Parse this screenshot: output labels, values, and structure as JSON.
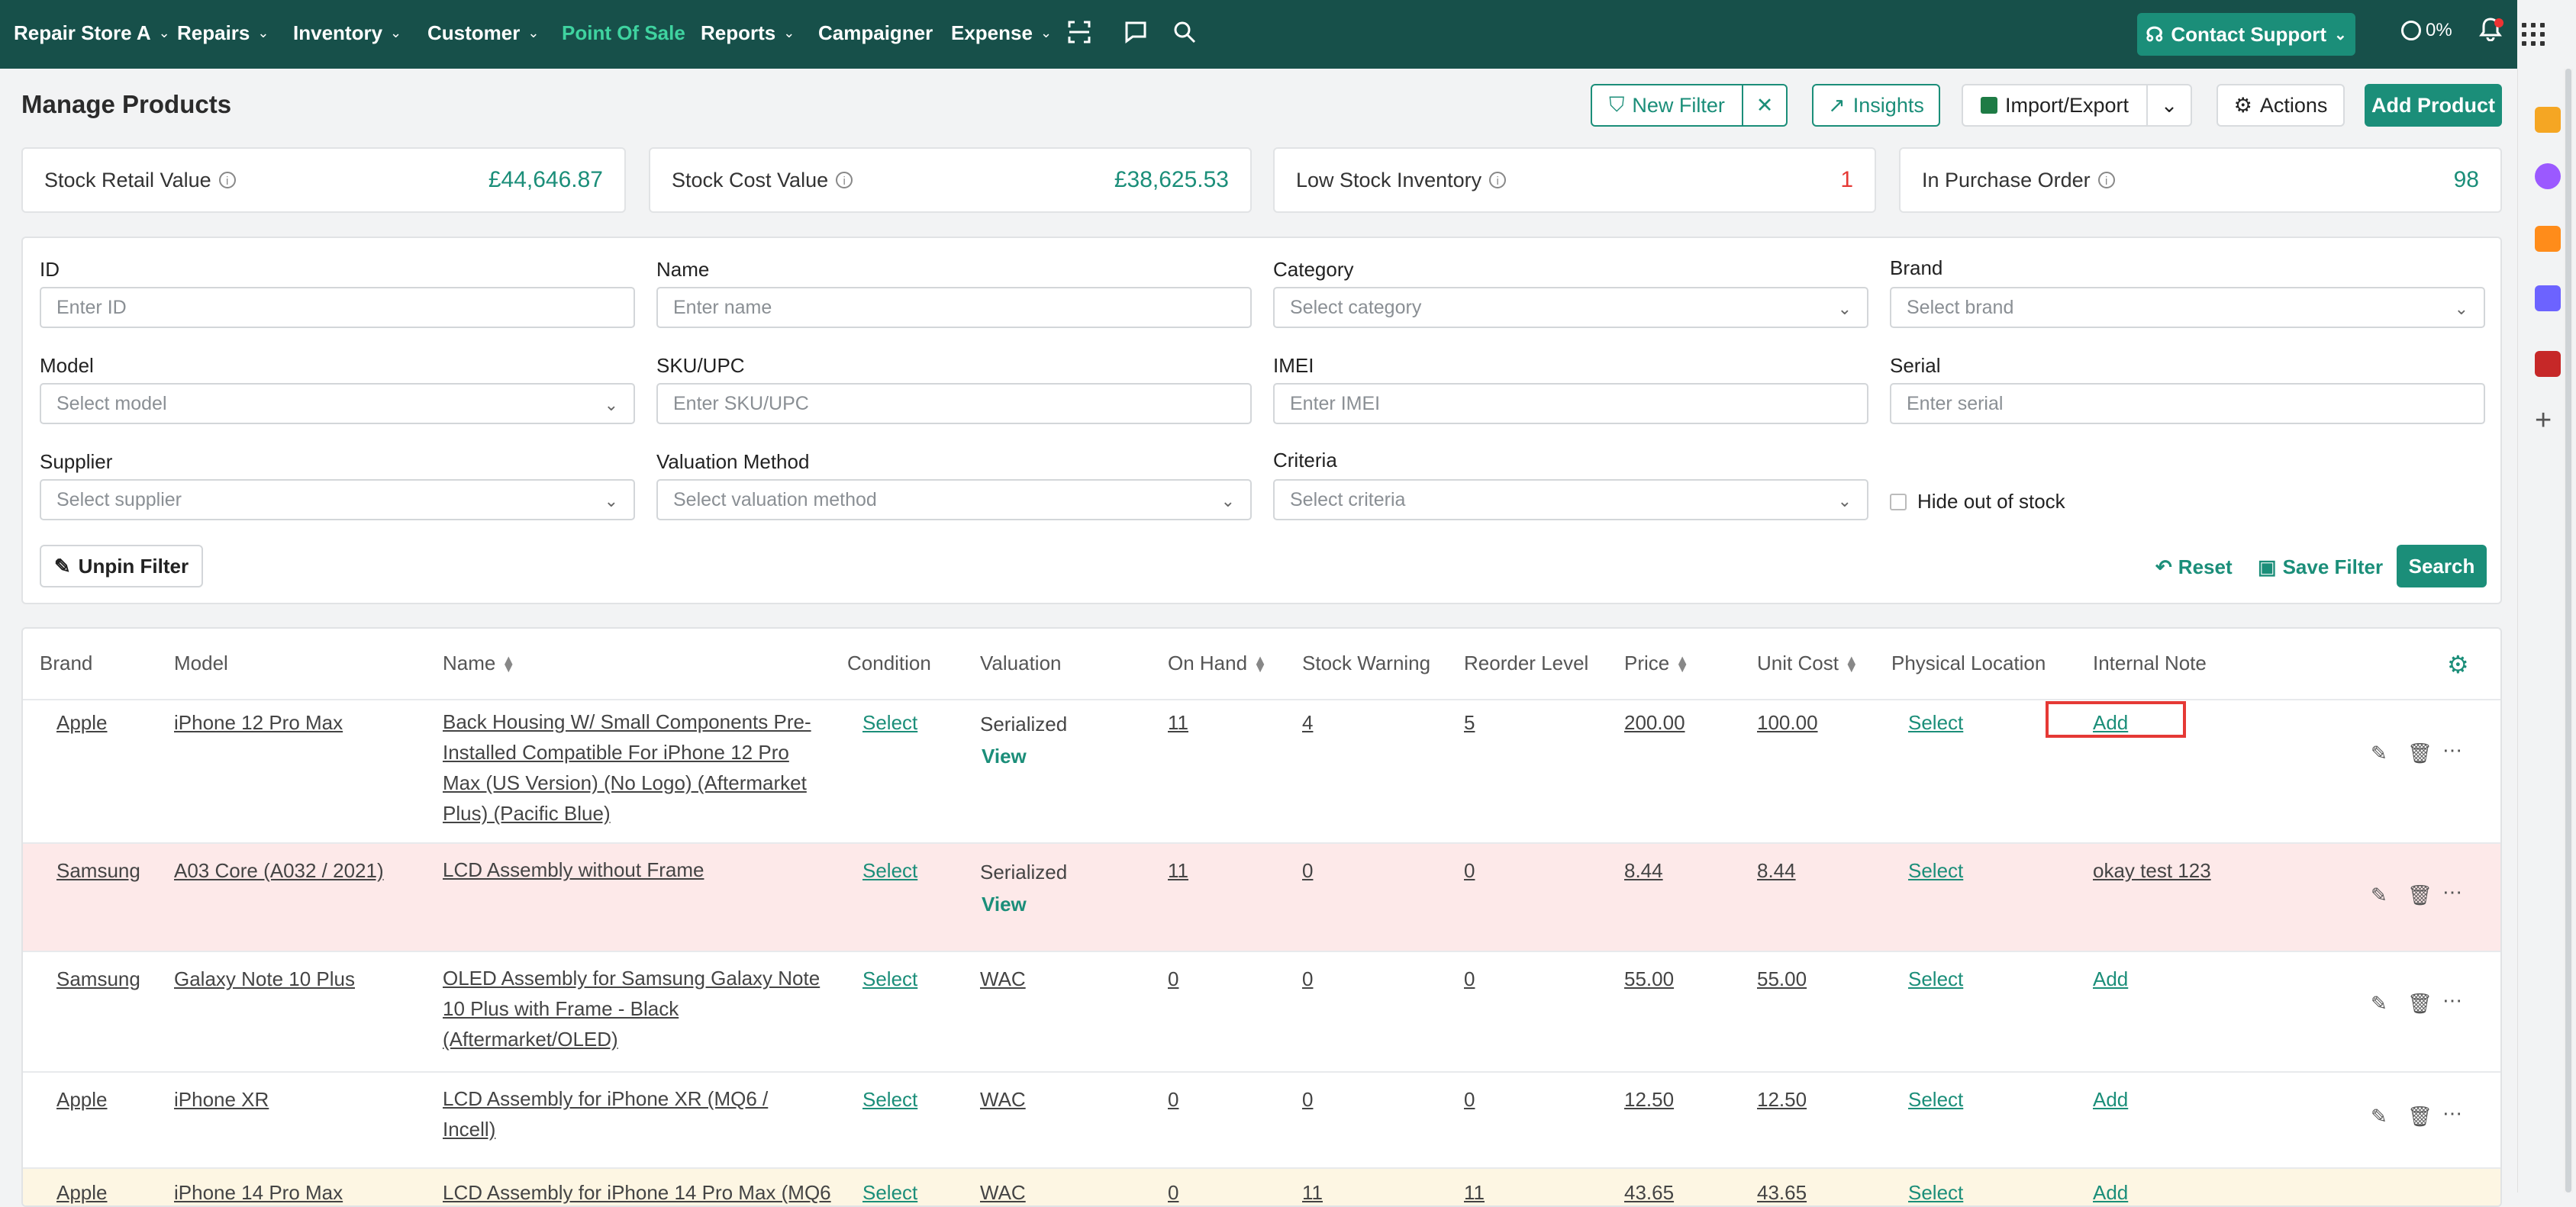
{
  "nav": {
    "store": "Repair Store A",
    "items": [
      "Repairs",
      "Inventory",
      "Customer",
      "Point Of Sale",
      "Reports",
      "Campaigner",
      "Expense"
    ],
    "active": "Point Of Sale",
    "support_label": "Contact Support",
    "usage": "0%"
  },
  "page": {
    "title": "Manage Products",
    "buttons": {
      "new_filter": "New Filter",
      "insights": "Insights",
      "import_export": "Import/Export",
      "actions": "Actions",
      "add_product": "Add Product"
    }
  },
  "stats": [
    {
      "label": "Stock Retail Value",
      "value": "£44,646.87"
    },
    {
      "label": "Stock Cost Value",
      "value": "£38,625.53"
    },
    {
      "label": "Low Stock Inventory",
      "value": "1"
    },
    {
      "label": "In Purchase Order",
      "value": "98"
    }
  ],
  "filters": {
    "id": {
      "label": "ID",
      "placeholder": "Enter ID"
    },
    "name": {
      "label": "Name",
      "placeholder": "Enter name"
    },
    "category": {
      "label": "Category",
      "placeholder": "Select category"
    },
    "brand": {
      "label": "Brand",
      "placeholder": "Select brand"
    },
    "model": {
      "label": "Model",
      "placeholder": "Select model"
    },
    "sku": {
      "label": "SKU/UPC",
      "placeholder": "Enter SKU/UPC"
    },
    "imei": {
      "label": "IMEI",
      "placeholder": "Enter IMEI"
    },
    "serial": {
      "label": "Serial",
      "placeholder": "Enter serial"
    },
    "supplier": {
      "label": "Supplier",
      "placeholder": "Select supplier"
    },
    "valuation": {
      "label": "Valuation Method",
      "placeholder": "Select valuation method"
    },
    "criteria": {
      "label": "Criteria",
      "placeholder": "Select criteria"
    },
    "hide_oos": "Hide out of stock",
    "unpin": "Unpin Filter",
    "reset": "Reset",
    "save": "Save Filter",
    "search": "Search"
  },
  "table": {
    "headers": [
      "Brand",
      "Model",
      "Name",
      "Condition",
      "Valuation",
      "On Hand",
      "Stock Warning",
      "Reorder Level",
      "Price",
      "Unit Cost",
      "Physical Location",
      "Internal Note"
    ],
    "view_label": "View",
    "rows": [
      {
        "brand": "Apple",
        "model": "iPhone 12 Pro Max",
        "name": "Back Housing W/ Small Components Pre-Installed Compatible For iPhone 12 Pro Max (US Version) (No Logo) (Aftermarket Plus) (Pacific Blue)",
        "condition": "Select",
        "valuation": "Serialized",
        "on_hand": "11",
        "stock_warning": "4",
        "reorder": "5",
        "price": "200.00",
        "unit_cost": "100.00",
        "location": "Select",
        "note": "Add"
      },
      {
        "brand": "Samsung",
        "model": "A03 Core (A032 / 2021)",
        "name": "LCD Assembly without Frame",
        "condition": "Select",
        "valuation": "Serialized",
        "on_hand": "11",
        "stock_warning": "0",
        "reorder": "0",
        "price": "8.44",
        "unit_cost": "8.44",
        "location": "Select",
        "note": "okay test 123"
      },
      {
        "brand": "Samsung",
        "model": "Galaxy Note 10 Plus",
        "name": "OLED Assembly for Samsung Galaxy Note 10 Plus with Frame - Black (Aftermarket/OLED)",
        "condition": "Select",
        "valuation": "WAC",
        "on_hand": "0",
        "stock_warning": "0",
        "reorder": "0",
        "price": "55.00",
        "unit_cost": "55.00",
        "location": "Select",
        "note": "Add"
      },
      {
        "brand": "Apple",
        "model": "iPhone XR",
        "name": "LCD Assembly for iPhone XR (MQ6 / Incell)",
        "condition": "Select",
        "valuation": "WAC",
        "on_hand": "0",
        "stock_warning": "0",
        "reorder": "0",
        "price": "12.50",
        "unit_cost": "12.50",
        "location": "Select",
        "note": "Add"
      },
      {
        "brand": "Apple",
        "model": "iPhone 14 Pro Max",
        "name": "LCD Assembly for iPhone 14 Pro Max (MQ6",
        "condition": "Select",
        "valuation": "WAC",
        "on_hand": "0",
        "stock_warning": "11",
        "reorder": "11",
        "price": "43.65",
        "unit_cost": "43.65",
        "location": "Select",
        "note": "Add"
      }
    ]
  }
}
